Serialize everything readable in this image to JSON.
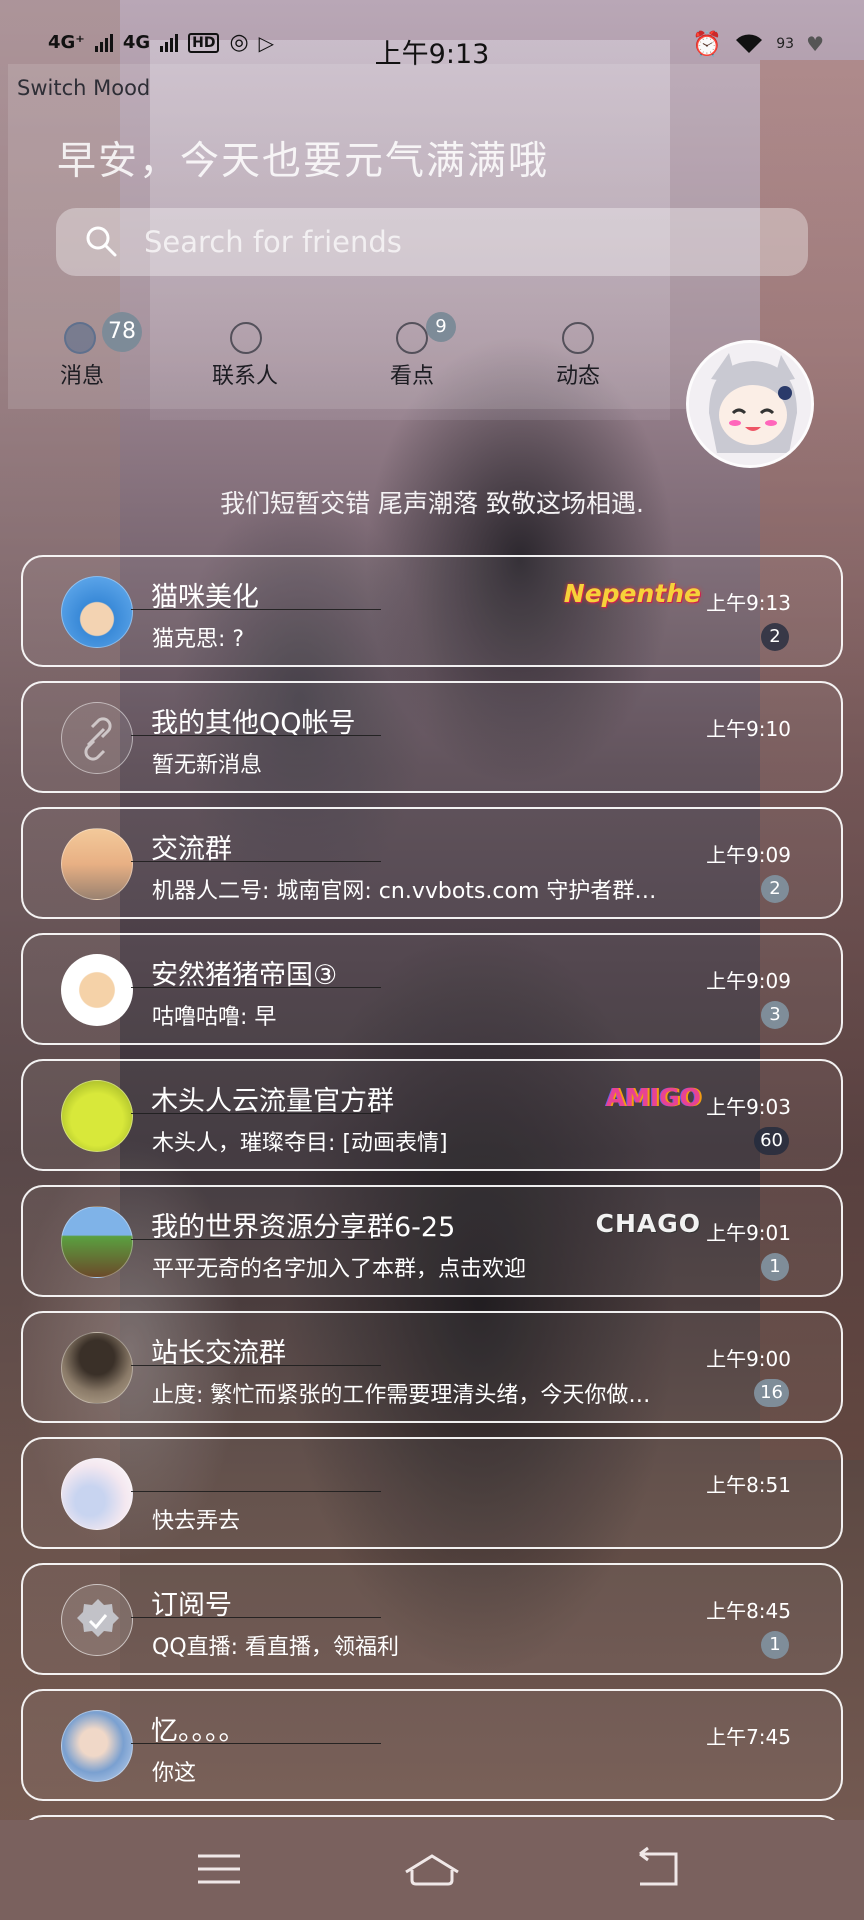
{
  "status_bar": {
    "network1": "4G⁺",
    "network2": "4G",
    "hd": "HD",
    "time": "上午9:13",
    "battery": "93"
  },
  "header": {
    "switch_mood": "Switch Mood",
    "greeting": "早安，今天也要元气满满哦",
    "search_placeholder": "Search for friends"
  },
  "tabs": [
    {
      "label": "消息",
      "badge": "78"
    },
    {
      "label": "联系人",
      "badge": ""
    },
    {
      "label": "看点",
      "badge": "9"
    },
    {
      "label": "动态",
      "badge": ""
    }
  ],
  "motto": "我们短暂交错 尾声潮落 致敬这场相遇.",
  "chats": [
    {
      "name": "猫咪美化",
      "preview": "猫克思: ?",
      "time": "上午9:13",
      "badge": "2",
      "tag": "Nepenthe"
    },
    {
      "name": "我的其他QQ帐号",
      "preview": "暂无新消息",
      "time": "上午9:10",
      "badge": "",
      "tag": ""
    },
    {
      "name": "交流群",
      "preview": "机器人二号: 城南官网: cn.vvbots.com 守护者群…",
      "time": "上午9:09",
      "badge": "2",
      "tag": ""
    },
    {
      "name": "安然猪猪帝国③",
      "preview": "咕噜咕噜: 早",
      "time": "上午9:09",
      "badge": "3",
      "tag": ""
    },
    {
      "name": "木头人云流量官方群",
      "preview": "木头人，璀璨夺目: [动画表情]",
      "time": "上午9:03",
      "badge": "60",
      "tag": "AMIGO"
    },
    {
      "name": "我的世界资源分享群6-25",
      "preview": "平平无奇的名字加入了本群，点击欢迎",
      "time": "上午9:01",
      "badge": "1",
      "tag": "CHAGO"
    },
    {
      "name": "站长交流群",
      "preview": "止度: 繁忙而紧张的工作需要理清头绪，今天你做…",
      "time": "上午9:00",
      "badge": "16",
      "tag": ""
    },
    {
      "name": "",
      "preview": "快去弄去",
      "time": "上午8:51",
      "badge": "",
      "tag": ""
    },
    {
      "name": "订阅号",
      "preview": "QQ直播: 看直播，领福利",
      "time": "上午8:45",
      "badge": "1",
      "tag": ""
    },
    {
      "name": "忆。。。。",
      "preview": "你这",
      "time": "上午7:45",
      "badge": "",
      "tag": ""
    }
  ],
  "colors": {
    "badge": "#7f8d99",
    "nav_bar": "#7a615e",
    "card_border": "#ffffff"
  }
}
